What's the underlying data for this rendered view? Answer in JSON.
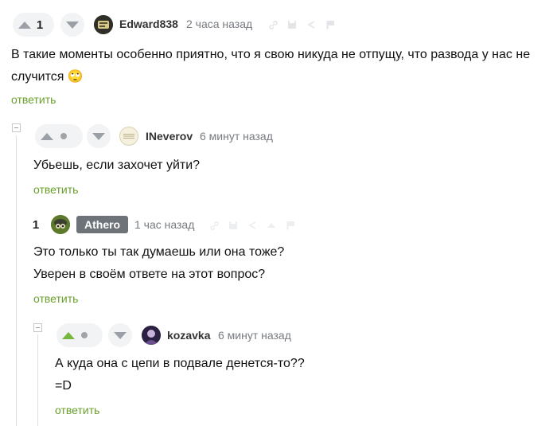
{
  "comments": [
    {
      "rating": "1",
      "user": "Edward838",
      "time": "2 часа назад",
      "text": "В такие моменты особенно приятно, что я свою никуда не отпущу, что развода у нас не случится",
      "emoji": "🙄",
      "reply": "ответить"
    },
    {
      "user": "INeverov",
      "time": "6 минут назад",
      "text": "Убьешь, если захочет уйти?",
      "reply": "ответить"
    },
    {
      "rating": "1",
      "user": "Athero",
      "time": "1 час назад",
      "text_line1": "Это только ты так думаешь или она тоже?",
      "text_line2": "Уверен в своём ответе на этот вопрос?",
      "reply": "ответить"
    },
    {
      "user": "kozavka",
      "time": "6 минут назад",
      "text_line1": "А куда она с цепи в подвале денется-то??",
      "text_line2": "=D",
      "reply": "ответить"
    }
  ],
  "colors": {
    "reply_link": "#6a9f2b",
    "upvote_active": "#78b73d",
    "vote_bg": "#f2f3f5",
    "author_tag": "#6e7379"
  },
  "icons": [
    "arrow-up-icon",
    "arrow-down-icon",
    "dot-icon",
    "link-icon",
    "save-icon",
    "share-icon",
    "report-flag-icon",
    "collapse-minus-icon"
  ]
}
